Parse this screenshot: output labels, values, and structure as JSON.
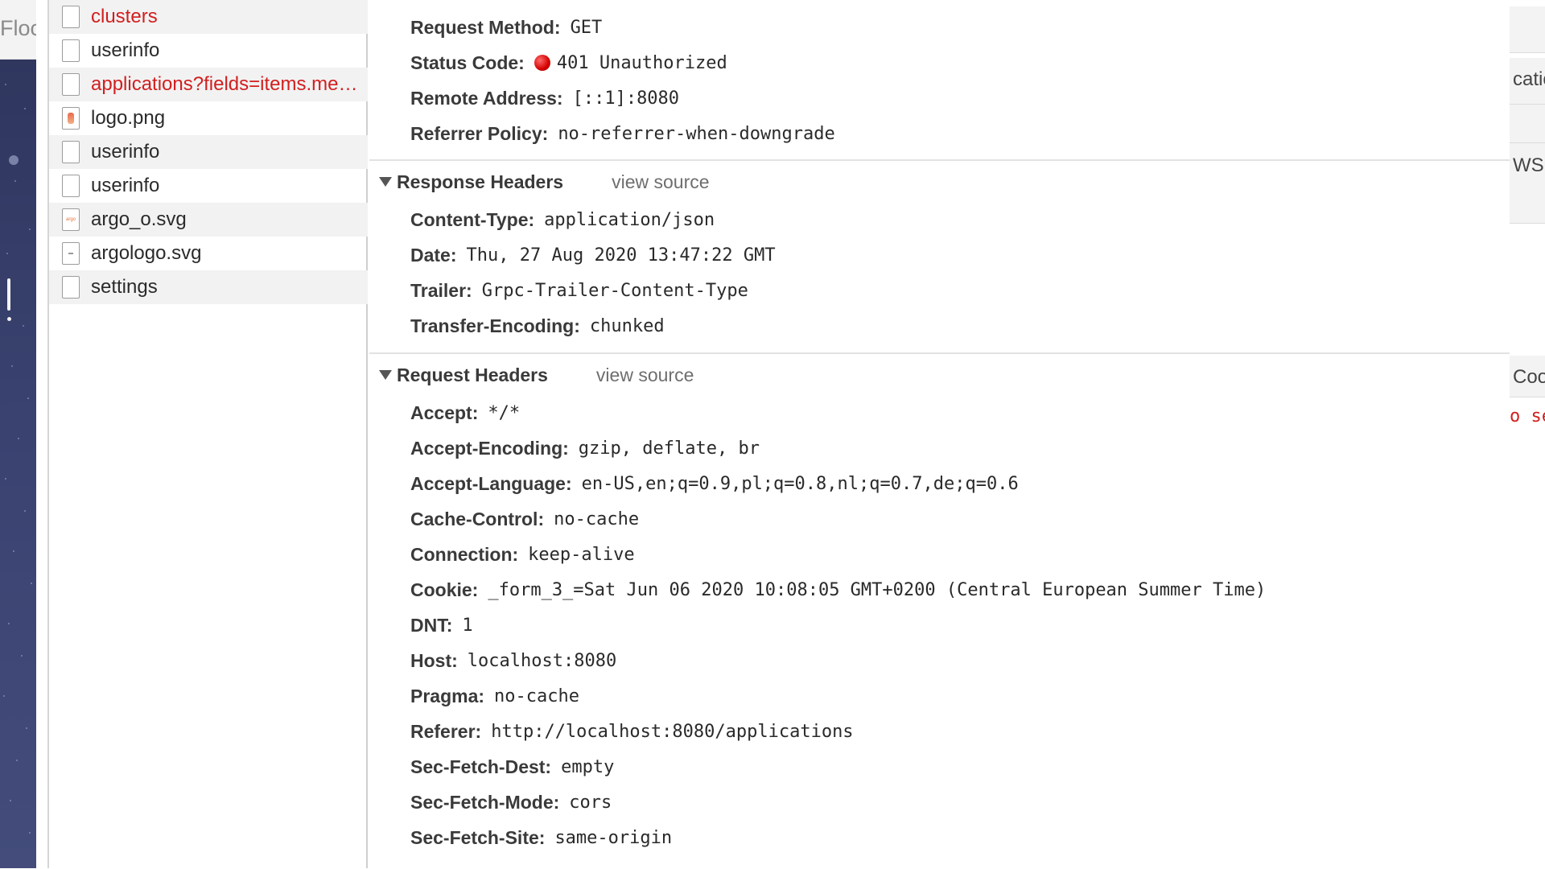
{
  "app_strip": {
    "top_text": "Floc"
  },
  "request_list": {
    "items": [
      {
        "name": "clusters",
        "error": true,
        "icon": "file-icon"
      },
      {
        "name": "userinfo",
        "error": false,
        "icon": "file-icon"
      },
      {
        "name": "applications?fields=items.me…",
        "error": true,
        "icon": "file-icon"
      },
      {
        "name": "logo.png",
        "error": false,
        "icon": "png-image-icon"
      },
      {
        "name": "userinfo",
        "error": false,
        "icon": "file-icon"
      },
      {
        "name": "userinfo",
        "error": false,
        "icon": "file-icon"
      },
      {
        "name": "argo_o.svg",
        "error": false,
        "icon": "svg-image-icon"
      },
      {
        "name": "argologo.svg",
        "error": false,
        "icon": "svg-image-icon"
      },
      {
        "name": "settings",
        "error": false,
        "icon": "file-icon"
      }
    ]
  },
  "general": [
    {
      "key": "Request Method:",
      "value": "GET"
    },
    {
      "key": "Status Code:",
      "value": "401 Unauthorized",
      "status_color": "#d40000"
    },
    {
      "key": "Remote Address:",
      "value": "[::1]:8080"
    },
    {
      "key": "Referrer Policy:",
      "value": "no-referrer-when-downgrade"
    }
  ],
  "response_headers": {
    "title": "Response Headers",
    "view_source": "view source",
    "items": [
      {
        "key": "Content-Type:",
        "value": "application/json"
      },
      {
        "key": "Date:",
        "value": "Thu, 27 Aug 2020 13:47:22 GMT"
      },
      {
        "key": "Trailer:",
        "value": "Grpc-Trailer-Content-Type"
      },
      {
        "key": "Transfer-Encoding:",
        "value": "chunked"
      }
    ]
  },
  "request_headers": {
    "title": "Request Headers",
    "view_source": "view source",
    "items": [
      {
        "key": "Accept:",
        "value": "*/*"
      },
      {
        "key": "Accept-Encoding:",
        "value": "gzip, deflate, br"
      },
      {
        "key": "Accept-Language:",
        "value": "en-US,en;q=0.9,pl;q=0.8,nl;q=0.7,de;q=0.6"
      },
      {
        "key": "Cache-Control:",
        "value": "no-cache"
      },
      {
        "key": "Connection:",
        "value": "keep-alive"
      },
      {
        "key": "Cookie:",
        "value": "_form_3_=Sat Jun 06 2020 10:08:05 GMT+0200 (Central European Summer Time)"
      },
      {
        "key": "DNT:",
        "value": "1"
      },
      {
        "key": "Host:",
        "value": "localhost:8080"
      },
      {
        "key": "Pragma:",
        "value": "no-cache"
      },
      {
        "key": "Referer:",
        "value": "http://localhost:8080/applications"
      },
      {
        "key": "Sec-Fetch-Dest:",
        "value": "empty"
      },
      {
        "key": "Sec-Fetch-Mode:",
        "value": "cors"
      },
      {
        "key": "Sec-Fetch-Site:",
        "value": "same-origin"
      }
    ]
  },
  "right_pane": {
    "text_1": "catic",
    "text_2": "WS",
    "text_3": "Coo",
    "text_4": "o se"
  }
}
